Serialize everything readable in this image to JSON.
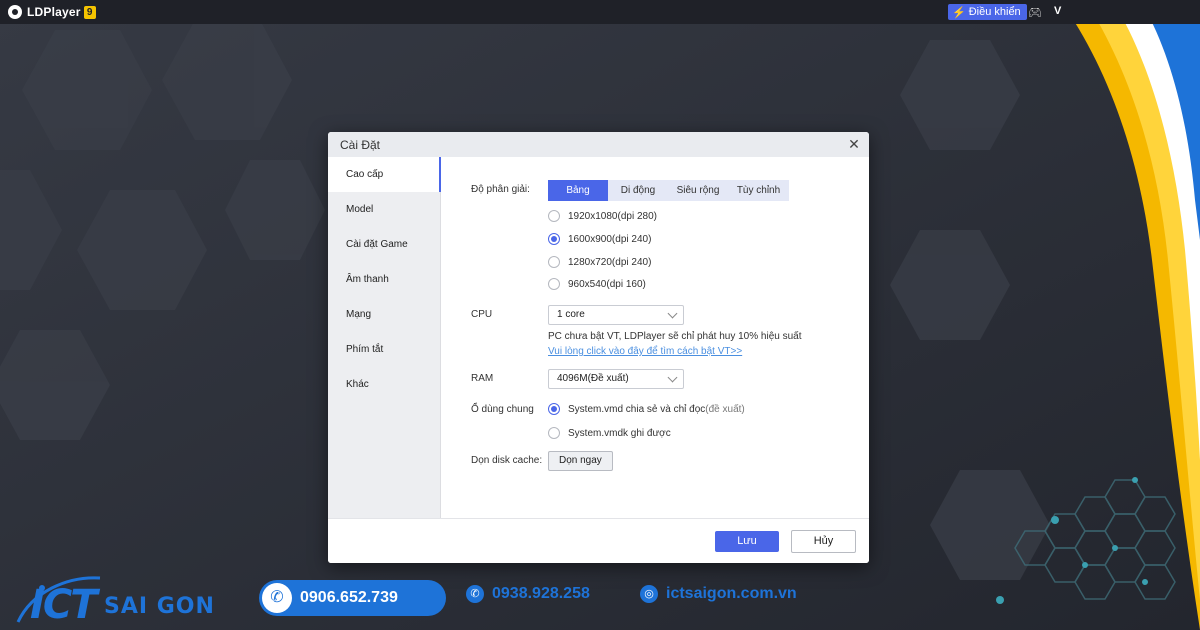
{
  "app": {
    "name": "LDPlayer",
    "version_badge": "9"
  },
  "topbar": {
    "control_label": "Điều khiển",
    "user_initial": "V"
  },
  "dialog": {
    "title": "Cài Đặt",
    "sidebar": [
      {
        "label": "Cao cấp",
        "active": true
      },
      {
        "label": "Model"
      },
      {
        "label": "Cài đặt Game"
      },
      {
        "label": "Âm thanh"
      },
      {
        "label": "Mạng"
      },
      {
        "label": "Phím tắt"
      },
      {
        "label": "Khác"
      }
    ],
    "resolution": {
      "label": "Độ phân giải:",
      "tabs": [
        "Bảng",
        "Di động",
        "Siêu rộng",
        "Tùy chỉnh"
      ],
      "active_tab": "Bảng",
      "options": [
        {
          "label": "1920x1080(dpi 280)",
          "checked": false
        },
        {
          "label": "1600x900(dpi 240)",
          "checked": true
        },
        {
          "label": "1280x720(dpi 240)",
          "checked": false
        },
        {
          "label": "960x540(dpi 160)",
          "checked": false
        }
      ]
    },
    "cpu": {
      "label": "CPU",
      "value": "1 core",
      "note": "PC chưa bật VT, LDPlayer sẽ chỉ phát huy 10% hiệu suất",
      "link": "Vui lòng click vào đây để tìm cách bật VT>>"
    },
    "ram": {
      "label": "RAM",
      "value": "4096M(Đề xuất)"
    },
    "disk": {
      "label": "Ổ dùng chung",
      "options": [
        {
          "label": "System.vmd chia sẻ và chỉ đọc",
          "suffix": "(đề xuất)",
          "checked": true
        },
        {
          "label": "System.vmdk ghi được",
          "checked": false
        }
      ]
    },
    "cache": {
      "label": "Dọn disk cache:",
      "button": "Dọn ngay"
    },
    "footer": {
      "save": "Lưu",
      "cancel": "Hủy"
    }
  },
  "branding": {
    "logo_ict": "ICT",
    "logo_sub": "SAI GON",
    "phone_primary": "0906.652.739",
    "phone_secondary": "0938.928.258",
    "website": "ictsaigon.com.vn",
    "accent": "#1e73d8"
  },
  "colors": {
    "primary": "#4a66e8",
    "background": "#2b2f39",
    "stripe_yellow": "#f5b800"
  }
}
